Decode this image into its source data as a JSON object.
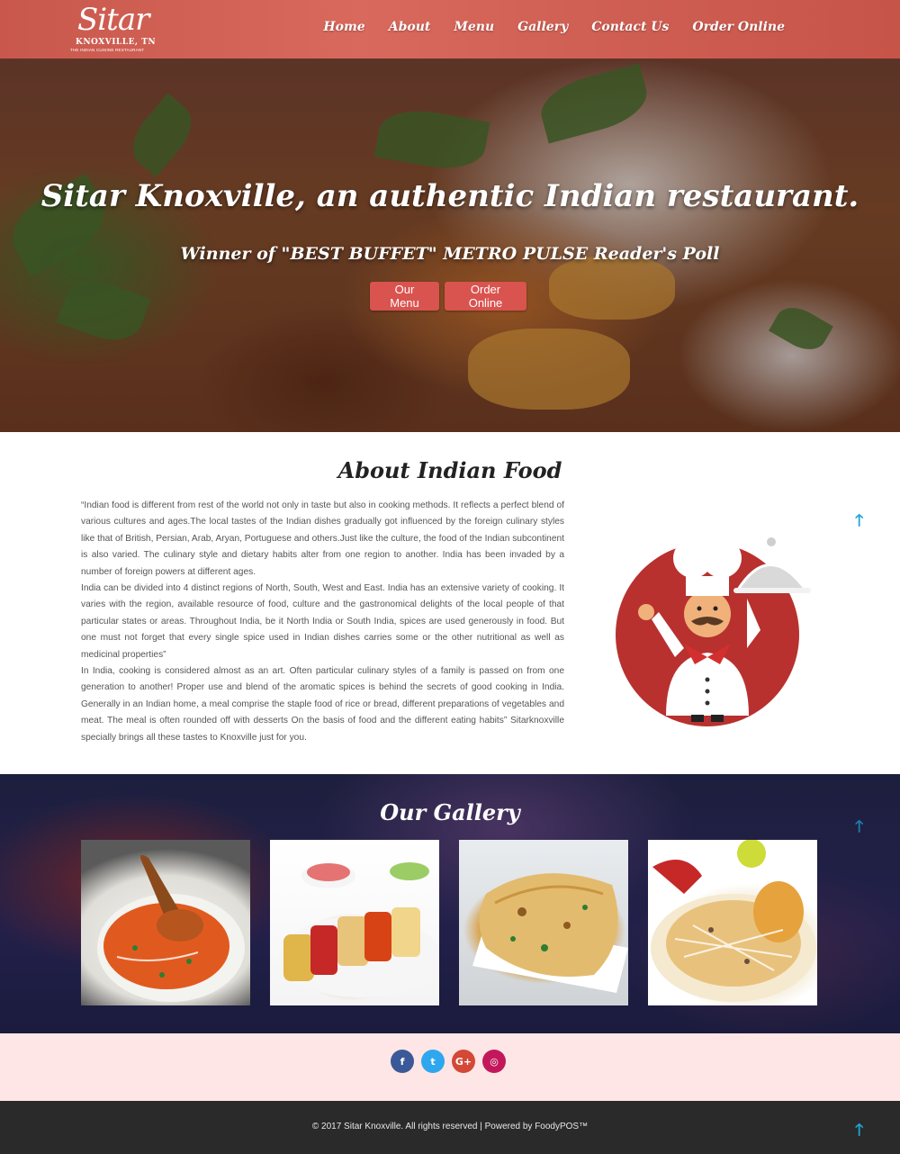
{
  "header": {
    "logo": {
      "script": "Sitar",
      "city": "KNOXVILLE, TN",
      "tagline": "THE INDIAN CUISINE RESTAURANT"
    },
    "nav": [
      "Home",
      "About",
      "Menu",
      "Gallery",
      "Contact Us",
      "Order Online"
    ]
  },
  "hero": {
    "title": "Sitar Knoxville, an authentic Indian restaurant.",
    "subtitle": "Winner of \"BEST BUFFET\" METRO PULSE Reader's Poll",
    "buttons": {
      "menu": "Our Menu",
      "order": "Order Online"
    }
  },
  "about": {
    "title": "About Indian Food",
    "paragraphs": [
      "“Indian food is different from rest of the world not only in taste but also in cooking methods. It reflects a perfect blend of various cultures and ages.The local tastes of the Indian dishes gradually got influenced by the foreign culinary styles like that of British, Persian, Arab, Aryan, Portuguese and others.Just like the culture, the food of the Indian subcontinent is also varied. The culinary style and dietary habits alter from one region to another. India has been invaded by a number of foreign powers at different ages.",
      "India can be divided into 4 distinct regions of North, South, West and East. India has an extensive variety of cooking. It varies with the region, available resource of food, culture and the gastronomical delights of the local people of that particular states or areas. Throughout India, be it North India or South India, spices are used generously in food. But one must not forget that every single spice used in Indian dishes carries some or the other nutritional as well as medicinal properties”",
      "In India, cooking is considered almost as an art. Often particular culinary styles of a family is passed on from one generation to another! Proper use and blend of the aromatic spices is behind the secrets of good cooking in India. Generally in an Indian home, a meal comprise the staple food of rice or bread, different preparations of vegetables and meat. The meal is often rounded off with desserts On the basis of food and the different eating habits” Sitarknoxville specially brings all these tastes to Knoxville just for you."
    ]
  },
  "gallery": {
    "title": "Our Gallery"
  },
  "social": {
    "icons": [
      "facebook-icon",
      "twitter-icon",
      "google-plus-icon",
      "instagram-icon"
    ],
    "glyphs": {
      "facebook": "f",
      "twitter": "t",
      "google": "G+",
      "instagram": "◎"
    }
  },
  "footer": {
    "text": "© 2017 Sitar Knoxville. All rights reserved | Powered by FoodyPOS™"
  },
  "icons": {
    "scroll_up": "🡑"
  },
  "colors": {
    "header": "#d8695c",
    "button": "#d9534f",
    "scroll_up": "#1ea5d8",
    "social_bg": "#fde6e5",
    "footer_bg": "#2a2a2a"
  }
}
